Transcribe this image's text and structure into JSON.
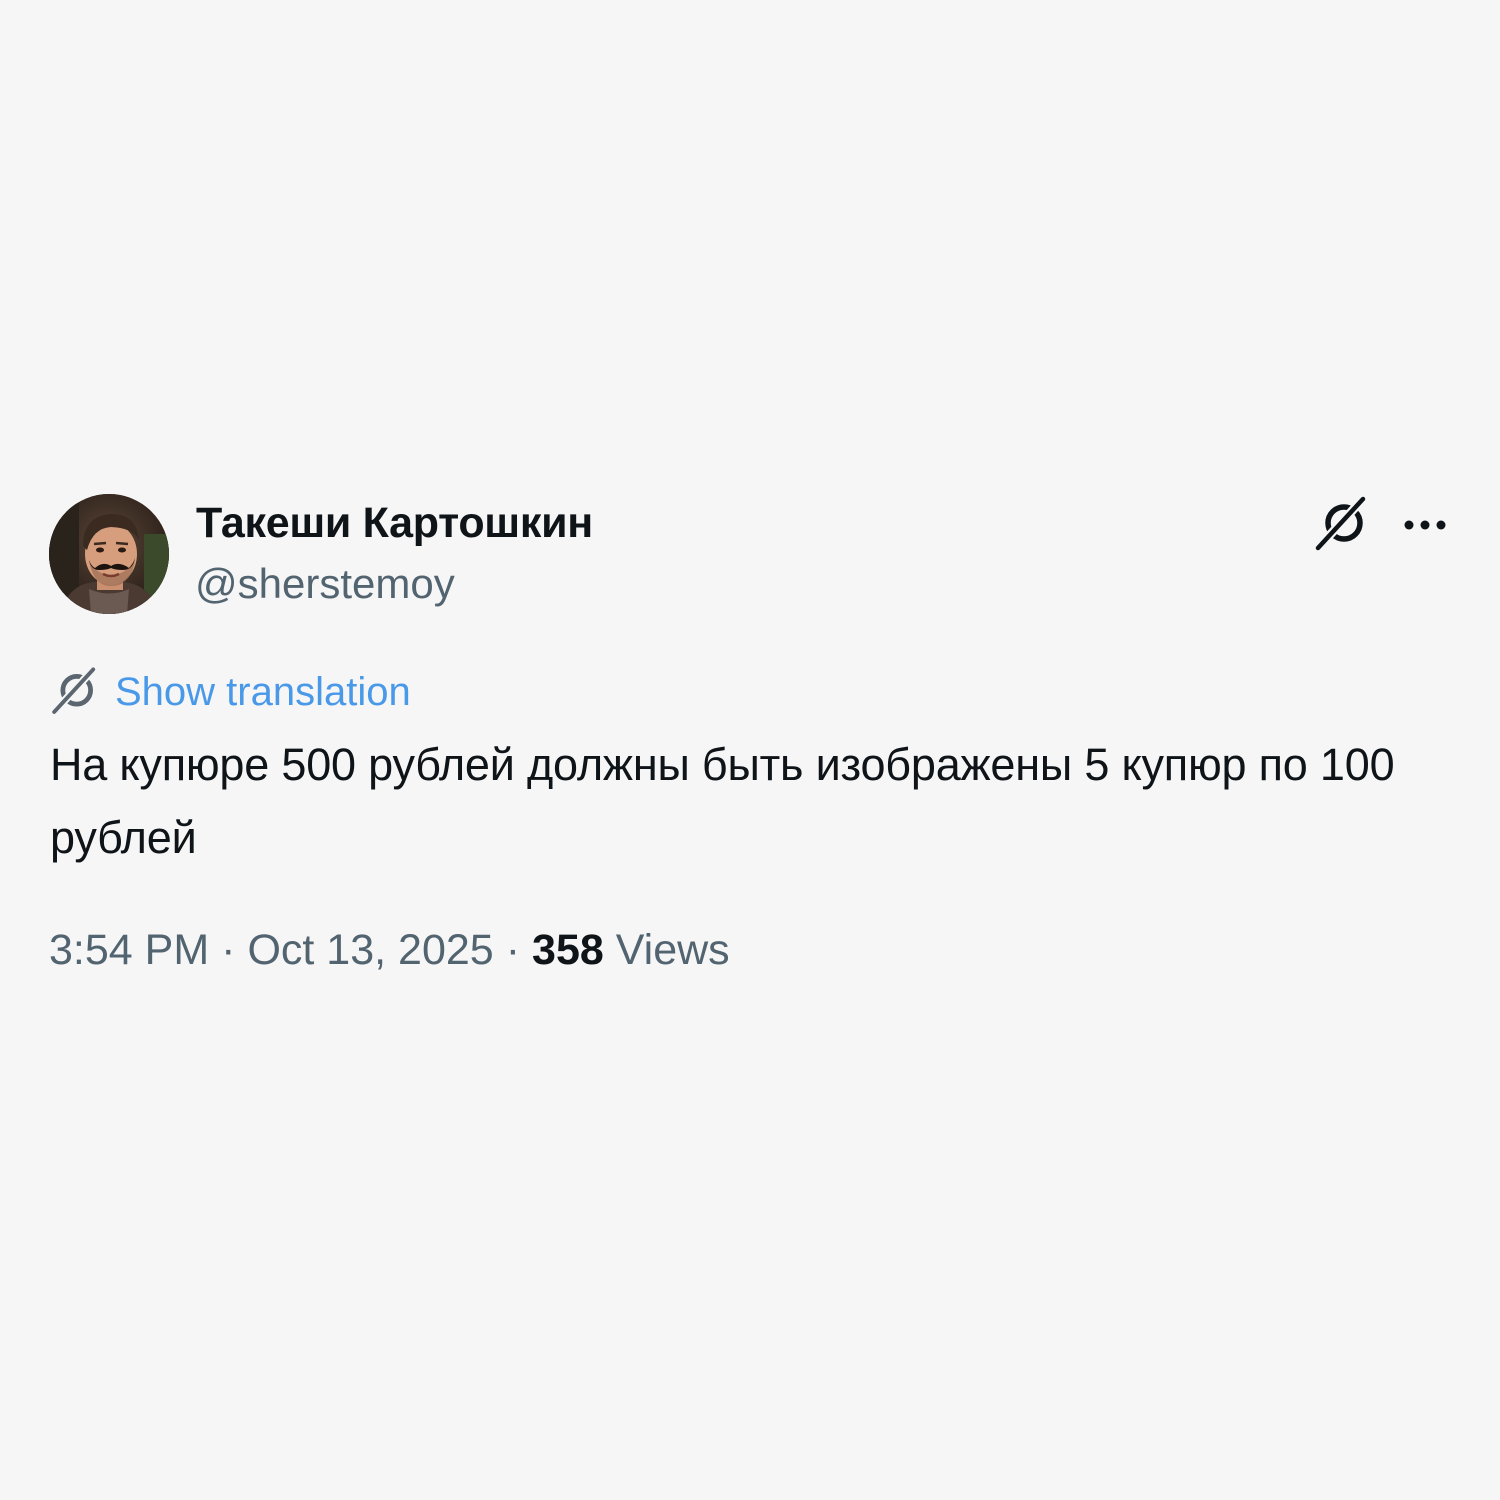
{
  "author": {
    "display_name": "Такеши Картошкин",
    "handle": "@sherstemoy",
    "avatar_icon": "avatar-photo"
  },
  "header_icons": {
    "grok": "grok-icon",
    "more": "more-icon"
  },
  "translation": {
    "icon": "grok-translate-icon",
    "label": "Show translation",
    "color": "#4a99e9"
  },
  "tweet": {
    "text": "На купюре 500 рублей должны быть изображены 5 купюр по 100 рублей"
  },
  "meta": {
    "time": "3:54 PM",
    "date": "Oct 13, 2025",
    "separator": "·",
    "views_count": "358",
    "views_label": "Views"
  },
  "colors": {
    "background": "#f6f6f6",
    "text_primary": "#0f1419",
    "text_secondary": "#536471",
    "link": "#4a99e9"
  }
}
